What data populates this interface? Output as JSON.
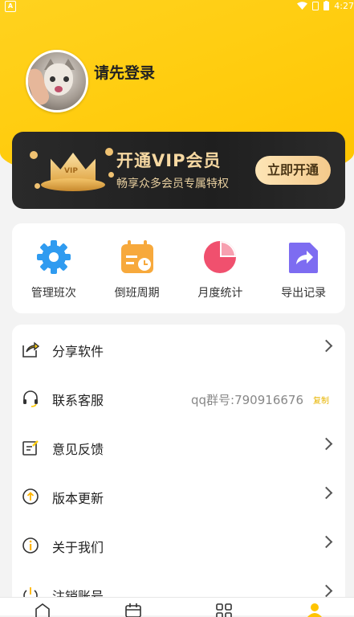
{
  "status": {
    "time": "4:27"
  },
  "profile": {
    "login_prompt": "请先登录"
  },
  "vip": {
    "badge_text": "VIP",
    "title": "开通VIP会员",
    "subtitle": "畅享众多会员专属特权",
    "button": "立即开通"
  },
  "tools": [
    {
      "label": "管理班次",
      "icon": "gear-icon"
    },
    {
      "label": "倒班周期",
      "icon": "calendar-clock-icon"
    },
    {
      "label": "月度统计",
      "icon": "pie-chart-icon"
    },
    {
      "label": "导出记录",
      "icon": "export-icon"
    }
  ],
  "menu": [
    {
      "label": "分享软件",
      "icon": "share-icon"
    },
    {
      "label": "联系客服",
      "icon": "headset-icon",
      "extra": "qq群号:790916676",
      "copy": "复制"
    },
    {
      "label": "意见反馈",
      "icon": "feedback-icon"
    },
    {
      "label": "版本更新",
      "icon": "update-icon"
    },
    {
      "label": "关于我们",
      "icon": "info-icon"
    },
    {
      "label": "注销账号",
      "icon": "power-icon"
    }
  ],
  "colors": {
    "brand_yellow": "#ffcd10",
    "gear_blue": "#2f9bf0",
    "calendar_orange": "#f7a93c",
    "pie_red": "#f0506e",
    "export_purple": "#7d6cf1"
  }
}
